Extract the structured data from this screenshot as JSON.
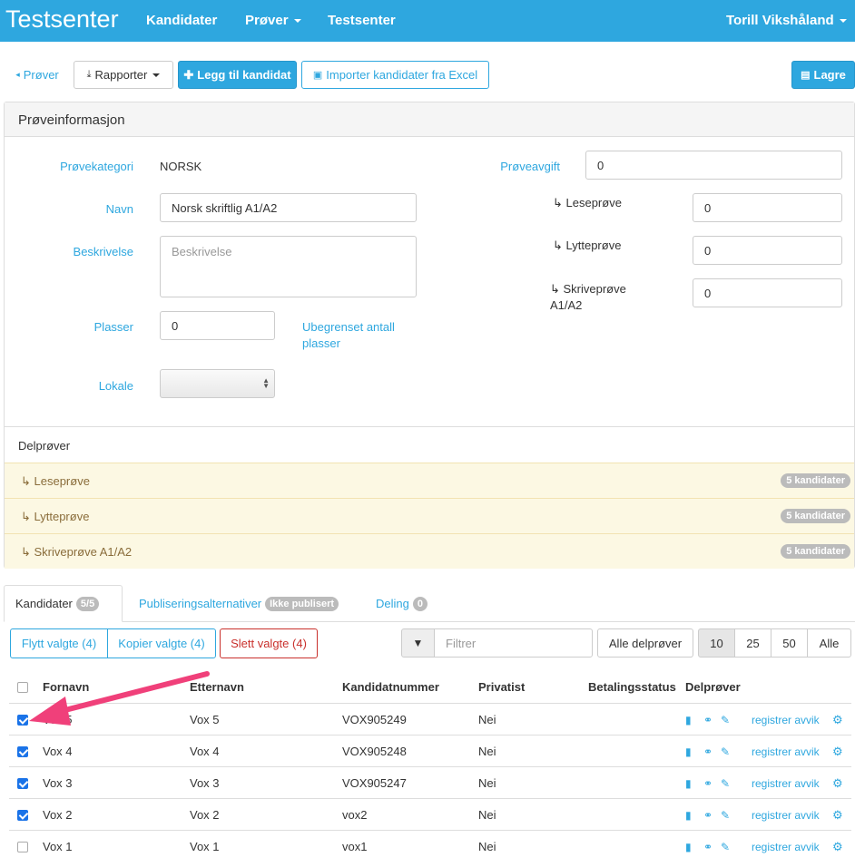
{
  "navbar": {
    "brand": "Testsenter",
    "items": [
      {
        "label": "Kandidater"
      },
      {
        "label": "Prøver"
      },
      {
        "label": "Testsenter"
      }
    ],
    "user": "Torill Vikshåland"
  },
  "toolbar": {
    "back": "Prøver",
    "reports": "Rapporter",
    "add": "Legg til kandidat",
    "import": "Importer kandidater fra Excel",
    "save": "Lagre"
  },
  "panel": {
    "title": "Prøveinformasjon",
    "kategori_label": "Prøvekategori",
    "kategori_value": "NORSK",
    "navn_label": "Navn",
    "navn_value": "Norsk skriftlig A1/A2",
    "beskrivelse_label": "Beskrivelse",
    "beskrivelse_placeholder": "Beskrivelse",
    "plasser_label": "Plasser",
    "plasser_value": "0",
    "plasser_hint": "Ubegrenset antall plasser",
    "lokale_label": "Lokale",
    "avgift_label": "Prøveavgift",
    "avgift_value": "0",
    "sub_fees": [
      {
        "label": "↳ Leseprøve",
        "value": "0"
      },
      {
        "label": "↳ Lytteprøve",
        "value": "0"
      },
      {
        "label": "↳ Skriveprøve A1/A2",
        "value": "0"
      }
    ],
    "delprover_title": "Delprøver",
    "delprover": [
      {
        "name": "↳ Leseprøve",
        "count": "5 kandidater"
      },
      {
        "name": "↳ Lytteprøve",
        "count": "5 kandidater"
      },
      {
        "name": "↳ Skriveprøve A1/A2",
        "count": "5 kandidater"
      }
    ]
  },
  "tabs": [
    {
      "label": "Kandidater",
      "badge": "5/5"
    },
    {
      "label": "Publiseringsalternativer",
      "badge": "Ikke publisert"
    },
    {
      "label": "Deling",
      "badge": "0"
    }
  ],
  "actions": {
    "move": "Flytt valgte (4)",
    "copy": "Kopier valgte (4)",
    "delete": "Slett valgte (4)",
    "filter_placeholder": "Filtrer",
    "all_parts": "Alle delprøver",
    "page_sizes": [
      "10",
      "25",
      "50",
      "Alle"
    ]
  },
  "table": {
    "headers": [
      "Fornavn",
      "Etternavn",
      "Kandidatnummer",
      "Privatist",
      "Betalingsstatus",
      "Delprøver"
    ],
    "rows": [
      {
        "fornavn": "Vox 5",
        "etternavn": "Vox 5",
        "nr": "VOX905249",
        "privatist": "Nei",
        "betaling": "",
        "checked": true,
        "link": "registrer avvik"
      },
      {
        "fornavn": "Vox 4",
        "etternavn": "Vox 4",
        "nr": "VOX905248",
        "privatist": "Nei",
        "betaling": "",
        "checked": true,
        "link": "registrer avvik"
      },
      {
        "fornavn": "Vox 3",
        "etternavn": "Vox 3",
        "nr": "VOX905247",
        "privatist": "Nei",
        "betaling": "",
        "checked": true,
        "link": "registrer avvik"
      },
      {
        "fornavn": "Vox 2",
        "etternavn": "Vox 2",
        "nr": "vox2",
        "privatist": "Nei",
        "betaling": "",
        "checked": true,
        "link": "registrer avvik"
      },
      {
        "fornavn": "Vox 1",
        "etternavn": "Vox 1",
        "nr": "vox1",
        "privatist": "Nei",
        "betaling": "",
        "checked": false,
        "link": "registrer avvik"
      }
    ]
  },
  "colors": {
    "accent": "#2ea7df",
    "annotation_arrow": "#f0407a"
  }
}
